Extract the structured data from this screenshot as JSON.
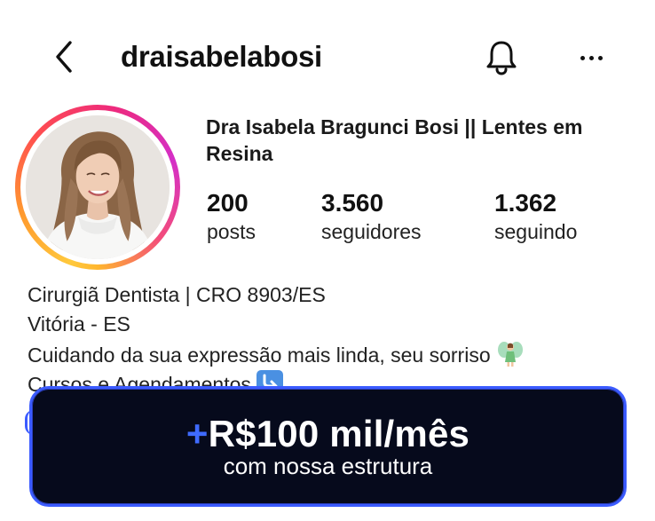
{
  "header": {
    "username": "draisabelabosi",
    "back_icon": "chevron-left-icon",
    "bell_icon": "bell-icon",
    "more_icon": "more-horizontal-icon"
  },
  "profile": {
    "full_name": "Dra Isabela Bragunci Bosi ||  Lentes em Resina",
    "avatar": "profile-photo"
  },
  "stats": {
    "posts": {
      "value": "200",
      "label": "posts"
    },
    "followers": {
      "value": "3.560",
      "label": "seguidores"
    },
    "following": {
      "value": "1.362",
      "label": "seguindo"
    }
  },
  "bio": {
    "line1": "Cirurgiã Dentista | CRO 8903/ES",
    "line2": "Vitória - ES",
    "line3": "Cuidando da sua expressão mais linda, seu sorriso",
    "line3_emoji": "fairy-emoji",
    "line4": "Cursos e Agendamentos",
    "line4_emoji": "arrow-down-right-emoji"
  },
  "cta": {
    "plus": "+",
    "headline": "R$100 mil/mês",
    "subtext": "com nossa estrutura"
  },
  "colors": {
    "cta_background": "#060a1c",
    "cta_border": "#3b5bff",
    "cta_plus": "#3f6bff",
    "text": "#111111"
  }
}
